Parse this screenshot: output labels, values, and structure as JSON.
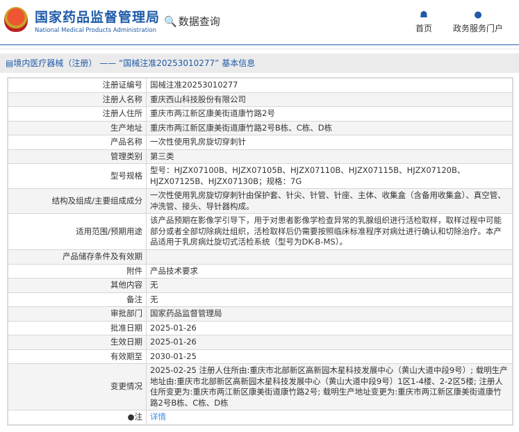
{
  "header": {
    "title_cn": "国家药品监督管理局",
    "title_en": "National Medical Products Administration",
    "query": "数据查询",
    "nav": [
      {
        "label": "首页",
        "icon": "home-icon"
      },
      {
        "label": "政务服务门户",
        "icon": "user-icon"
      }
    ]
  },
  "breadcrumb": "境内医疗器械（注册） ——  “国械注准20253010277”  基本信息",
  "rows": [
    {
      "label": "注册证编号",
      "value": "国械注准20253010277"
    },
    {
      "label": "注册人名称",
      "value": "重庆西山科技股份有限公司"
    },
    {
      "label": "注册人住所",
      "value": "重庆市两江新区康美街道康竹路2号"
    },
    {
      "label": "生产地址",
      "value": "重庆市两江新区康美街道康竹路2号B栋、C栋、D栋"
    },
    {
      "label": "产品名称",
      "value": "一次性使用乳房旋切穿刺针"
    },
    {
      "label": "管理类别",
      "value": "第三类"
    },
    {
      "label": "型号规格",
      "value": "型号：HJZX07100B、HJZX07105B、HJZX07110B、HJZX07115B、HJZX07120B、HJZX07125B、HJZX07130B；规格：7G"
    },
    {
      "label": "结构及组成/主要组成成分",
      "value": "一次性使用乳房旋切穿刺针由保护套、针尖、针管、针座、主体、收集盒（含备用收集盒）、真空管、冲洗管、接头、导针器构成。"
    },
    {
      "label": "适用范围/预期用途",
      "value": "该产品预期在影像学引导下，用于对患者影像学检查异常的乳腺组织进行活检取样，取样过程中可能部分或者全部切除病灶组织，活检取样后仍需要按照临床标准程序对病灶进行确认和切除治疗。本产品适用于乳房病灶旋切式活检系统（型号为DK-B-MS）。"
    },
    {
      "label": "产品储存条件及有效期",
      "value": ""
    },
    {
      "label": "附件",
      "value": "产品技术要求"
    },
    {
      "label": "其他内容",
      "value": "无"
    },
    {
      "label": "备注",
      "value": "无"
    },
    {
      "label": "审批部门",
      "value": "国家药品监督管理局"
    },
    {
      "label": "批准日期",
      "value": "2025-01-26"
    },
    {
      "label": "生效日期",
      "value": "2025-01-26"
    },
    {
      "label": "有效期至",
      "value": "2030-01-25"
    },
    {
      "label": "变更情况",
      "value": "2025-02-25 注册人住所由:重庆市北部新区高新园木星科技发展中心（黄山大道中段9号）; 载明生产地址由:重庆市北部新区高新园木星科技发展中心（黄山大道中段9号）1区1-4楼、2-2区5楼; 注册人住所变更为:重庆市两江新区康美街道康竹路2号; 载明生产地址变更为:重庆市两江新区康美街道康竹路2号B栋、C栋、D栋"
    }
  ],
  "note": {
    "label": "注",
    "link": "详情"
  }
}
